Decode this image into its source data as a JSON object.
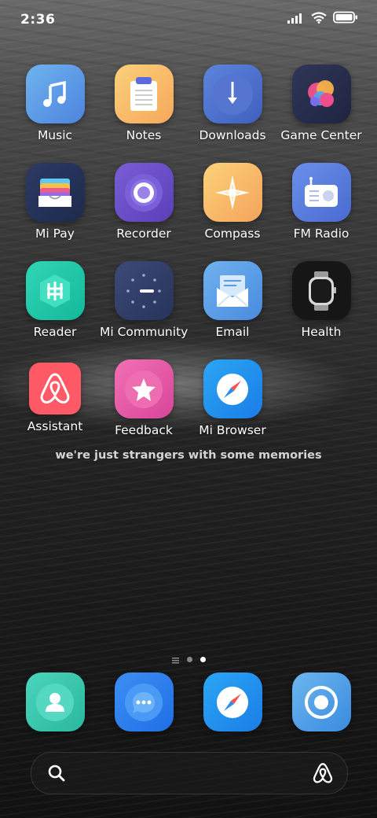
{
  "status_bar": {
    "time": "2:36"
  },
  "apps": [
    {
      "label": "Music",
      "icon": "music-icon"
    },
    {
      "label": "Notes",
      "icon": "notes-icon"
    },
    {
      "label": "Downloads",
      "icon": "downloads-icon"
    },
    {
      "label": "Game Center",
      "icon": "game-center-icon"
    },
    {
      "label": "Mi Pay",
      "icon": "wallet-icon"
    },
    {
      "label": "Recorder",
      "icon": "recorder-icon"
    },
    {
      "label": "Compass",
      "icon": "compass-icon"
    },
    {
      "label": "FM Radio",
      "icon": "radio-icon"
    },
    {
      "label": "Reader",
      "icon": "reader-icon"
    },
    {
      "label": "Mi Community",
      "icon": "community-icon"
    },
    {
      "label": "Email",
      "icon": "email-icon"
    },
    {
      "label": "Health",
      "icon": "watch-icon"
    },
    {
      "label": "Assistant",
      "icon": "airbnb-icon"
    },
    {
      "label": "Feedback",
      "icon": "star-icon"
    },
    {
      "label": "Mi Browser",
      "icon": "browser-compass-icon"
    }
  ],
  "quote": "we're just strangers with some memories",
  "dock": [
    {
      "icon": "contacts-icon"
    },
    {
      "icon": "messages-icon"
    },
    {
      "icon": "browser-icon"
    },
    {
      "icon": "camera-icon"
    }
  ],
  "colors": {
    "accent": "#3a8ef0",
    "background": "#2a2a2a"
  }
}
